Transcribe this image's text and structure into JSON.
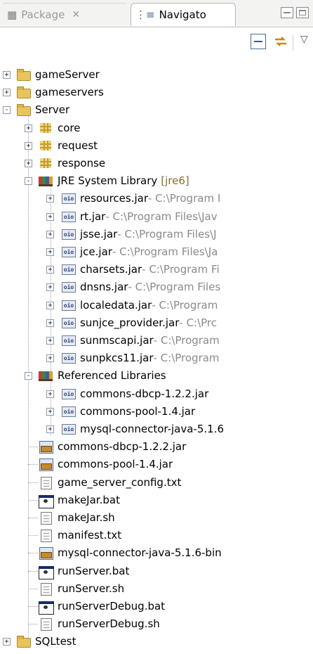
{
  "tabs": {
    "package_label": "Package",
    "navigator_label": "Navigato",
    "close_glyph": "✕"
  },
  "tree": {
    "projects": [
      {
        "label": "gameServer"
      },
      {
        "label": "gameservers"
      },
      {
        "label": "Server"
      }
    ],
    "packages": [
      {
        "label": "core"
      },
      {
        "label": "request"
      },
      {
        "label": "response"
      }
    ],
    "jre": {
      "label": "JRE System Library",
      "suffix": "[jre6]"
    },
    "jre_jars": [
      {
        "label": "resources.jar",
        "path": " - C:\\Program I"
      },
      {
        "label": "rt.jar",
        "path": " - C:\\Program Files\\Jav"
      },
      {
        "label": "jsse.jar",
        "path": " - C:\\Program Files\\J"
      },
      {
        "label": "jce.jar",
        "path": " - C:\\Program Files\\Ja"
      },
      {
        "label": "charsets.jar",
        "path": " - C:\\Program Fi"
      },
      {
        "label": "dnsns.jar",
        "path": " - C:\\Program Files"
      },
      {
        "label": "localedata.jar",
        "path": " - C:\\Program"
      },
      {
        "label": "sunjce_provider.jar",
        "path": " - C:\\Prc"
      },
      {
        "label": "sunmscapi.jar",
        "path": " - C:\\Program"
      },
      {
        "label": "sunpkcs11.jar",
        "path": " - C:\\Program"
      }
    ],
    "ref_libs": {
      "label": "Referenced Libraries"
    },
    "ref_jars": [
      {
        "label": "commons-dbcp-1.2.2.jar"
      },
      {
        "label": "commons-pool-1.4.jar"
      },
      {
        "label": "mysql-connector-java-5.1.6"
      }
    ],
    "files": [
      {
        "label": "commons-dbcp-1.2.2.jar",
        "icon": "jar-file-icon"
      },
      {
        "label": "commons-pool-1.4.jar",
        "icon": "jar-file-icon"
      },
      {
        "label": "game_server_config.txt",
        "icon": "text-file-icon"
      },
      {
        "label": "makeJar.bat",
        "icon": "batch-file-icon"
      },
      {
        "label": "makeJar.sh",
        "icon": "text-file-icon"
      },
      {
        "label": "manifest.txt",
        "icon": "text-file-icon"
      },
      {
        "label": "mysql-connector-java-5.1.6-bin",
        "icon": "jar-file-icon"
      },
      {
        "label": "runServer.bat",
        "icon": "batch-file-icon"
      },
      {
        "label": "runServer.sh",
        "icon": "text-file-icon"
      },
      {
        "label": "runServerDebug.bat",
        "icon": "batch-file-icon"
      },
      {
        "label": "runServerDebug.sh",
        "icon": "text-file-icon"
      }
    ],
    "last_project": {
      "label": "SQLtest"
    }
  }
}
